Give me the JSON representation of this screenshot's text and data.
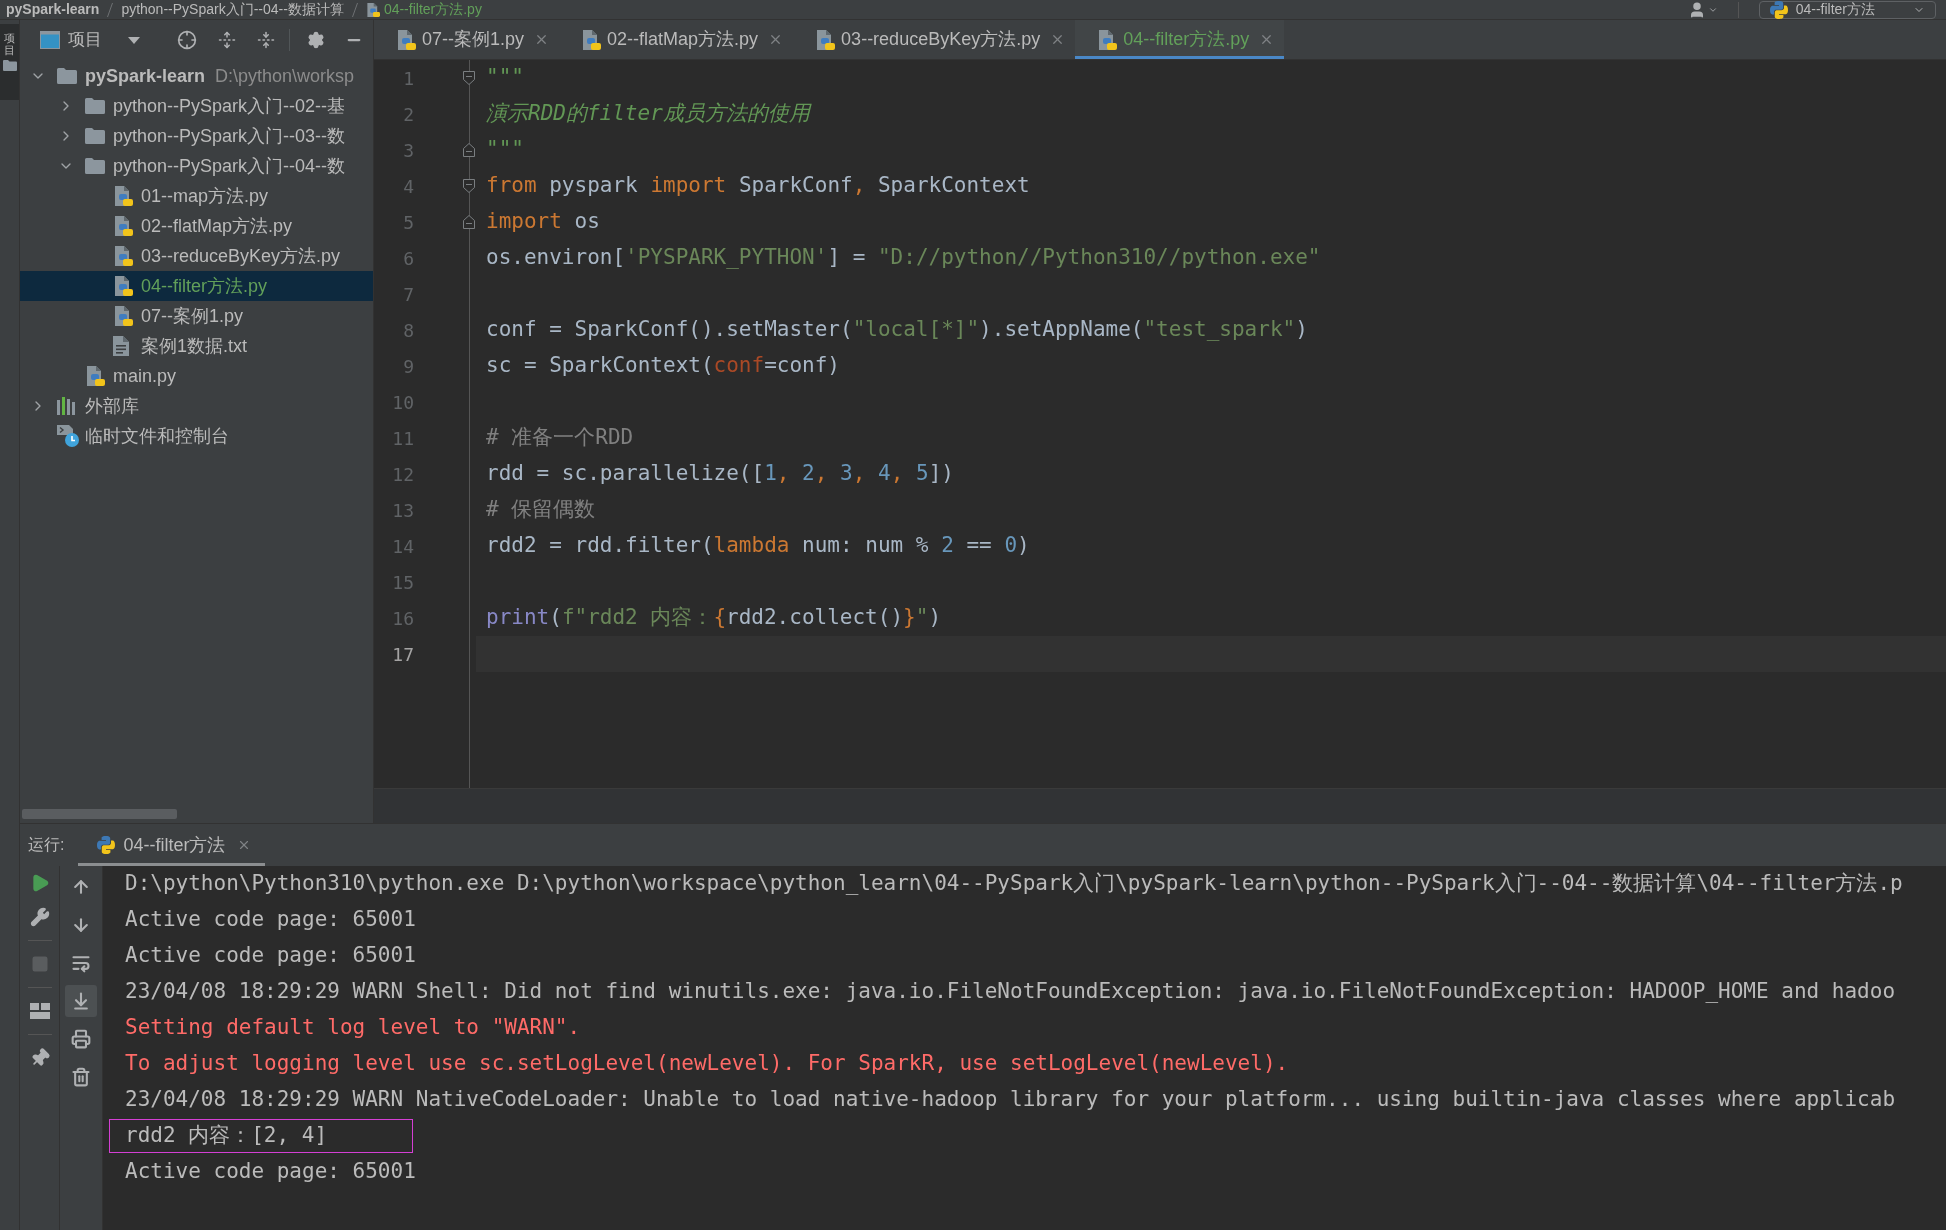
{
  "top_bar": {
    "breadcrumb": [
      {
        "label": "pySpark-learn",
        "kind": "project",
        "added": false
      },
      {
        "label": "python--PySpark入门--04--数据计算",
        "kind": "folder",
        "added": false
      },
      {
        "label": "04--filter方法.py",
        "kind": "python",
        "added": true
      }
    ],
    "run_config": {
      "label": "04--filter方法"
    }
  },
  "side_strip": {
    "label": "项目",
    "selected": true
  },
  "project_panel": {
    "title": "项目",
    "tree": [
      {
        "name": "pySpark-learn",
        "path": "D:\\python\\worksp",
        "kind": "project",
        "expanded": true,
        "selected": false,
        "children": [
          {
            "name": "python--PySpark入门--02--基",
            "kind": "folder",
            "expanded": false,
            "selected": false
          },
          {
            "name": "python--PySpark入门--03--数",
            "kind": "folder",
            "expanded": false,
            "selected": false
          },
          {
            "name": "python--PySpark入门--04--数",
            "kind": "folder",
            "expanded": true,
            "selected": false,
            "children": [
              {
                "name": "01--map方法.py",
                "kind": "python",
                "selected": false,
                "added": false
              },
              {
                "name": "02--flatMap方法.py",
                "kind": "python",
                "selected": false,
                "added": false
              },
              {
                "name": "03--reduceByKey方法.py",
                "kind": "python",
                "selected": false,
                "added": false
              },
              {
                "name": "04--filter方法.py",
                "kind": "python",
                "selected": true,
                "added": true
              },
              {
                "name": "07--案例1.py",
                "kind": "python",
                "selected": false,
                "added": false
              },
              {
                "name": "案例1数据.txt",
                "kind": "text",
                "selected": false,
                "added": false
              }
            ]
          },
          {
            "name": "main.py",
            "kind": "python",
            "selected": false,
            "added": false
          }
        ]
      },
      {
        "name": "外部库",
        "kind": "library",
        "expanded": false,
        "selected": false
      },
      {
        "name": "临时文件和控制台",
        "kind": "scratch",
        "selected": false
      }
    ]
  },
  "editor": {
    "tabs": [
      {
        "label": "07--案例1.py",
        "selected": false,
        "added": false
      },
      {
        "label": "02--flatMap方法.py",
        "selected": false,
        "added": false
      },
      {
        "label": "03--reduceByKey方法.py",
        "selected": false,
        "added": false
      },
      {
        "label": "04--filter方法.py",
        "selected": true,
        "added": true
      }
    ],
    "lines": [
      {
        "number": "1",
        "current": false,
        "kind": "fold_start",
        "tokens": [
          {
            "text": "\"\"\"",
            "kind": "docstring"
          }
        ]
      },
      {
        "number": "2",
        "current": false,
        "kind": "plain",
        "tokens": [
          {
            "text": "演示RDD的filter成员方法的使用",
            "kind": "docstring"
          }
        ]
      },
      {
        "number": "3",
        "current": false,
        "kind": "fold_end",
        "tokens": [
          {
            "text": "\"\"\"",
            "kind": "docstring"
          }
        ]
      },
      {
        "number": "4",
        "current": false,
        "kind": "fold_start",
        "tokens": [
          {
            "text": "from",
            "kind": "keyword"
          },
          {
            "text": " pyspark ",
            "kind": "plain"
          },
          {
            "text": "import",
            "kind": "keyword"
          },
          {
            "text": " SparkConf",
            "kind": "plain"
          },
          {
            "text": ",",
            "kind": "keyword"
          },
          {
            "text": " SparkContext",
            "kind": "plain"
          }
        ]
      },
      {
        "number": "5",
        "current": false,
        "kind": "fold_end",
        "tokens": [
          {
            "text": "import",
            "kind": "keyword"
          },
          {
            "text": " os",
            "kind": "plain"
          }
        ]
      },
      {
        "number": "6",
        "current": false,
        "kind": "plain",
        "tokens": [
          {
            "text": "os.environ[",
            "kind": "plain"
          },
          {
            "text": "'PYSPARK_PYTHON'",
            "kind": "string"
          },
          {
            "text": "] = ",
            "kind": "plain"
          },
          {
            "text": "\"D://python//Python310//python.exe\"",
            "kind": "string"
          }
        ]
      },
      {
        "number": "7",
        "current": false,
        "kind": "plain"
      },
      {
        "number": "8",
        "current": false,
        "kind": "plain",
        "tokens": [
          {
            "text": "conf = SparkConf().setMaster(",
            "kind": "plain"
          },
          {
            "text": "\"local[*]\"",
            "kind": "string"
          },
          {
            "text": ").setAppName(",
            "kind": "plain"
          },
          {
            "text": "\"test_spark\"",
            "kind": "string"
          },
          {
            "text": ")",
            "kind": "plain"
          }
        ]
      },
      {
        "number": "9",
        "current": false,
        "kind": "plain",
        "tokens": [
          {
            "text": "sc = SparkContext(",
            "kind": "plain"
          },
          {
            "text": "conf",
            "kind": "param"
          },
          {
            "text": "=conf)",
            "kind": "plain"
          }
        ]
      },
      {
        "number": "10",
        "current": false,
        "kind": "plain"
      },
      {
        "number": "11",
        "current": false,
        "kind": "plain",
        "tokens": [
          {
            "text": "# 准备一个RDD",
            "kind": "comment"
          }
        ]
      },
      {
        "number": "12",
        "current": false,
        "kind": "plain",
        "tokens": [
          {
            "text": "rdd = sc.parallelize([",
            "kind": "plain"
          },
          {
            "text": "1",
            "kind": "number"
          },
          {
            "text": ", ",
            "kind": "keyword"
          },
          {
            "text": "2",
            "kind": "number"
          },
          {
            "text": ", ",
            "kind": "keyword"
          },
          {
            "text": "3",
            "kind": "number"
          },
          {
            "text": ", ",
            "kind": "keyword"
          },
          {
            "text": "4",
            "kind": "number"
          },
          {
            "text": ", ",
            "kind": "keyword"
          },
          {
            "text": "5",
            "kind": "number"
          },
          {
            "text": "])",
            "kind": "plain"
          }
        ]
      },
      {
        "number": "13",
        "current": false,
        "kind": "plain",
        "tokens": [
          {
            "text": "# 保留偶数",
            "kind": "comment"
          }
        ]
      },
      {
        "number": "14",
        "current": false,
        "kind": "plain",
        "tokens": [
          {
            "text": "rdd2 = rdd.filter(",
            "kind": "plain"
          },
          {
            "text": "lambda",
            "kind": "keyword"
          },
          {
            "text": " num: num % ",
            "kind": "plain"
          },
          {
            "text": "2",
            "kind": "number"
          },
          {
            "text": " == ",
            "kind": "plain"
          },
          {
            "text": "0",
            "kind": "number"
          },
          {
            "text": ")",
            "kind": "plain"
          }
        ]
      },
      {
        "number": "15",
        "current": false,
        "kind": "plain"
      },
      {
        "number": "16",
        "current": false,
        "kind": "plain",
        "tokens": [
          {
            "text": "print",
            "kind": "builtin"
          },
          {
            "text": "(",
            "kind": "plain"
          },
          {
            "text": "f\"rdd2 内容：",
            "kind": "string"
          },
          {
            "text": "{",
            "kind": "keyword"
          },
          {
            "text": "rdd2.collect()",
            "kind": "plain"
          },
          {
            "text": "}",
            "kind": "keyword"
          },
          {
            "text": "\"",
            "kind": "string"
          },
          {
            "text": ")",
            "kind": "plain"
          }
        ]
      },
      {
        "number": "17",
        "current": true,
        "kind": "plain"
      }
    ]
  },
  "run_panel": {
    "label": "运行:",
    "tab": {
      "label": "04--filter方法",
      "selected": true
    },
    "stop_button": {
      "disabled": true
    },
    "scroll_to_end_button": {
      "on": true
    },
    "console": [
      {
        "text": "D:\\python\\Python310\\python.exe D:\\python\\workspace\\python_learn\\04--PySpark入门\\pySpark-learn\\python--PySpark入门--04--数据计算\\04--filter方法.p",
        "kind": "out",
        "highlighted": false
      },
      {
        "text": "Active code page: 65001",
        "kind": "out",
        "highlighted": false
      },
      {
        "text": "Active code page: 65001",
        "kind": "out",
        "highlighted": false
      },
      {
        "text": "23/04/08 18:29:29 WARN Shell: Did not find winutils.exe: java.io.FileNotFoundException: java.io.FileNotFoundException: HADOOP_HOME and hadoo",
        "kind": "out",
        "highlighted": false
      },
      {
        "text": "Setting default log level to \"WARN\".",
        "kind": "err",
        "highlighted": false
      },
      {
        "text": "To adjust logging level use sc.setLogLevel(newLevel). For SparkR, use setLogLevel(newLevel).",
        "kind": "err",
        "highlighted": false
      },
      {
        "text": "23/04/08 18:29:29 WARN NativeCodeLoader: Unable to load native-hadoop library for your platform... using builtin-java classes where applicab",
        "kind": "out",
        "highlighted": false
      },
      {
        "text": "rdd2 内容：[2, 4]",
        "kind": "out",
        "highlighted": true
      },
      {
        "text": "Active code page: 65001",
        "kind": "out",
        "highlighted": false
      }
    ]
  }
}
